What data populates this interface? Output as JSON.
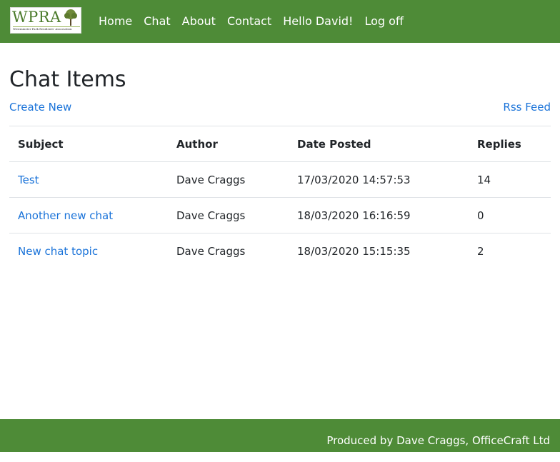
{
  "brand": {
    "logo_text": "WPRA",
    "logo_subtitle": "Westminster Park Residents' Association"
  },
  "nav": {
    "items": [
      {
        "label": "Home"
      },
      {
        "label": "Chat"
      },
      {
        "label": "About"
      },
      {
        "label": "Contact"
      },
      {
        "label": "Hello David!"
      },
      {
        "label": "Log off"
      }
    ]
  },
  "page": {
    "title": "Chat Items",
    "create_new": "Create New",
    "rss_feed": "Rss Feed"
  },
  "table": {
    "headers": [
      "Subject",
      "Author",
      "Date Posted",
      "Replies"
    ],
    "rows": [
      {
        "subject": "Test",
        "author": "Dave Craggs",
        "date": "17/03/2020 14:57:53",
        "replies": "14"
      },
      {
        "subject": "Another new chat",
        "author": "Dave Craggs",
        "date": "18/03/2020 16:16:59",
        "replies": "0"
      },
      {
        "subject": "New chat topic",
        "author": "Dave Craggs",
        "date": "18/03/2020 15:15:35",
        "replies": "2"
      }
    ]
  },
  "footer": {
    "text": "Produced by Dave Craggs, OfficeCraft Ltd"
  },
  "colors": {
    "brand_green": "#4e8b37",
    "link_blue": "#1a73d9"
  }
}
